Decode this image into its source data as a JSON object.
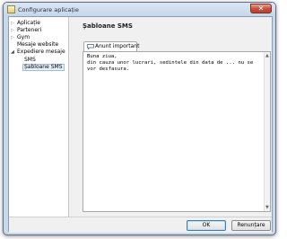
{
  "window": {
    "title": "Configurare aplicație",
    "close_label": "✕"
  },
  "tree": {
    "items": [
      {
        "label": "Aplicație",
        "expander": "▷",
        "level": 0
      },
      {
        "label": "Parteneri",
        "expander": "▷",
        "level": 0
      },
      {
        "label": "Gym",
        "expander": "▷",
        "level": 0
      },
      {
        "label": "Mesaje website",
        "expander": "",
        "level": 0
      },
      {
        "label": "Expediere mesaje",
        "expander": "◢",
        "level": 0
      },
      {
        "label": "SMS",
        "expander": "",
        "level": 1
      },
      {
        "label": "Șabloane SMS",
        "expander": "",
        "level": 1,
        "selected": true
      }
    ]
  },
  "main": {
    "title": "Șabloane SMS",
    "tab_label": "Anunt important",
    "tab_icon": "speech-bubble-icon",
    "template_text": "Buna ziua,\ndin cauza unor lucrari, sedintele din data de ... nu se vor desfasura."
  },
  "footer": {
    "ok_label": "OK",
    "cancel_label": "Renunțare"
  },
  "colors": {
    "accent": "#3c7fb1",
    "selection": "#e6f0fb"
  }
}
